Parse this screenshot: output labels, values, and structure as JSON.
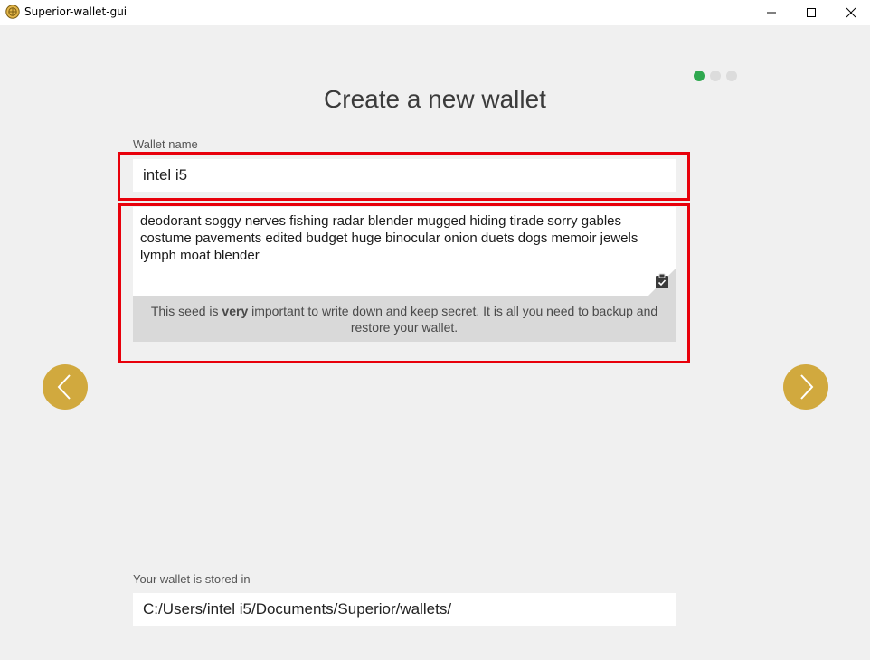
{
  "window": {
    "title": "Superior-wallet-gui",
    "app_icon": "superior-logo-icon",
    "controls": [
      "minimize-icon",
      "maximize-icon",
      "close-icon"
    ]
  },
  "progress": {
    "current_step": 1,
    "total_steps": 3,
    "active_color": "#2fa84f",
    "inactive_color": "#dcdcdc"
  },
  "page": {
    "title": "Create a new wallet"
  },
  "wallet_name": {
    "label": "Wallet name",
    "value": "intel i5"
  },
  "seed": {
    "words": "deodorant soggy nerves fishing radar blender mugged hiding tirade sorry gables costume pavements edited budget huge binocular onion duets dogs memoir jewels lymph moat blender",
    "copy_icon": "clipboard-check-icon",
    "note_before": "This seed is ",
    "note_emphasis": "very",
    "note_after": " important to write down and keep secret. It is all you need to backup and restore your wallet."
  },
  "storage": {
    "label": "Your wallet is stored in",
    "path": "C:/Users/intel i5/Documents/Superior/wallets/"
  },
  "navigation": {
    "prev_icon": "chevron-left-icon",
    "next_icon": "chevron-right-icon",
    "button_color": "#d1a93e"
  },
  "highlight_color": "#e8000b"
}
